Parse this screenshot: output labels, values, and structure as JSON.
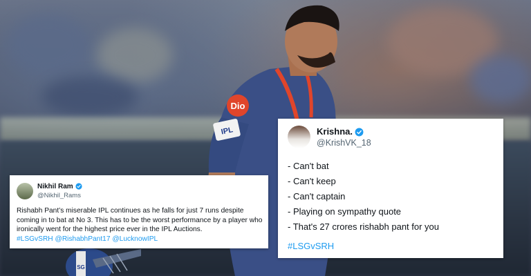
{
  "tweets": {
    "left": {
      "name": "Nikhil Ram",
      "handle": "@Nikhil_Rams",
      "text": "Rishabh Pant’s miserable IPL continues as he falls for just 7 runs despite coming in to bat at No 3. This has to be the worst performance by a player who ironically went for the highest price ever in the IPL Auctions.",
      "hashtags": "#LSGvSRH @RishabhPant17 @LucknowIPL"
    },
    "right": {
      "name": "Krishna.",
      "handle": "@KrishVK_18",
      "lines": [
        "- Can't bat",
        "- Can't keep",
        "- Can't captain",
        "- Playing on sympathy quote",
        "- That's 27 crores rishabh pant for you"
      ],
      "hashtag": "#LSGvSRH"
    }
  },
  "photo": {
    "jersey_text": "IPL",
    "sponsor_text": "Dio",
    "bat_text": "SG"
  },
  "colors": {
    "verified": "#1d9bf0",
    "link": "#1d9bf0",
    "jersey": "#3a4f86",
    "jersey_stripe": "#e0452b"
  }
}
